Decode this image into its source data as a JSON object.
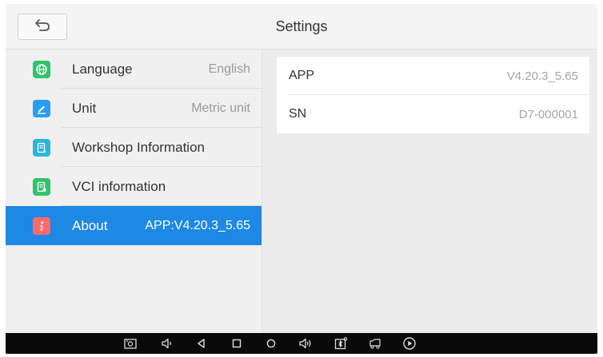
{
  "header": {
    "title": "Settings",
    "back_icon": "back-arrow-icon"
  },
  "sidebar": {
    "items": [
      {
        "label": "Language",
        "value": "English",
        "icon": "globe-icon",
        "icon_color": "#2fc46b",
        "active": false
      },
      {
        "label": "Unit",
        "value": "Metric unit",
        "icon": "pencil-icon",
        "icon_color": "#2a9df4",
        "active": false
      },
      {
        "label": "Workshop Information",
        "value": "",
        "icon": "document-icon",
        "icon_color": "#29b6d8",
        "active": false
      },
      {
        "label": "VCI information",
        "value": "",
        "icon": "vci-document-icon",
        "icon_color": "#2fc46b",
        "active": false
      },
      {
        "label": "About",
        "value": "APP:V4.20.3_5.65",
        "icon": "info-icon",
        "icon_color": "#ff6b6b",
        "active": true
      }
    ]
  },
  "about": {
    "rows": [
      {
        "label": "APP",
        "value": "V4.20.3_5.65"
      },
      {
        "label": "SN",
        "value": "D7-000001"
      }
    ]
  },
  "navbar": {
    "icons": [
      "screenshot-icon",
      "volume-down-icon",
      "back-icon",
      "recent-apps-icon",
      "home-icon",
      "volume-up-icon",
      "vci-status-icon",
      "truck-icon",
      "play-icon"
    ]
  },
  "colors": {
    "accent": "#1e88e5",
    "navbar": "#0a0a0a"
  }
}
